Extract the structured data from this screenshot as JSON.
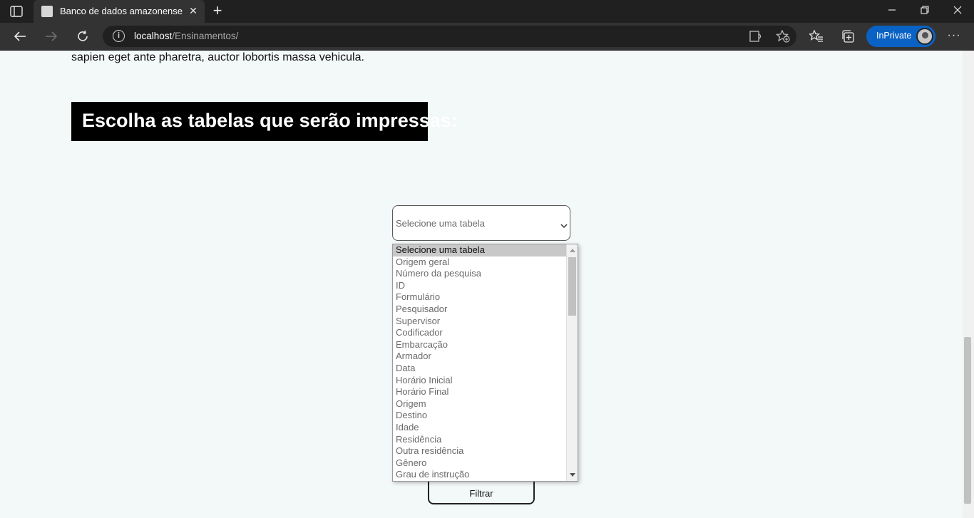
{
  "browser": {
    "tab_title": "Banco de dados amazonense",
    "url_host": "localhost",
    "url_path": "/Ensinamentos/",
    "inprivate_label": "InPrivate"
  },
  "content": {
    "paragraph_tail": "sapien eget ante pharetra, auctor lobortis massa vehicula.",
    "heading": "Escolha as tabelas que serão impressas:",
    "select_value": "Selecione uma tabela",
    "filter_label": "Filtrar"
  },
  "dropdown": {
    "options": [
      "Selecione uma tabela",
      "Origem geral",
      "Número da pesquisa",
      "ID",
      "Formulário",
      "Pesquisador",
      "Supervisor",
      "Codificador",
      "Embarcação",
      "Armador",
      "Data",
      "Horário Inicial",
      "Horário Final",
      "Origem",
      "Destino",
      "Idade",
      "Residência",
      "Outra residência",
      "Gênero",
      "Grau de instrução"
    ],
    "selected_index": 0
  },
  "colors": {
    "titlebar": "#202020",
    "toolbar": "#333333",
    "inprivate": "#0a62c4",
    "page_bg": "#f3f8f8",
    "heading_bg": "#000000"
  }
}
